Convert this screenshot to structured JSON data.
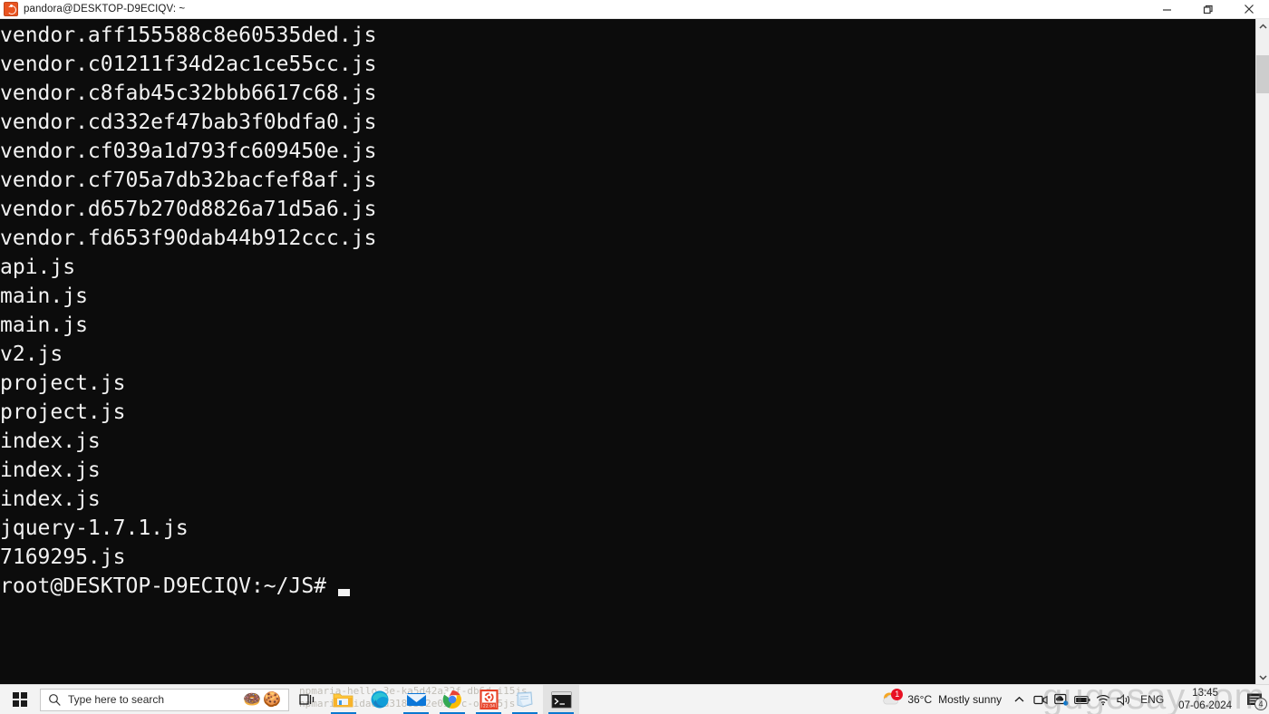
{
  "window": {
    "title": "pandora@DESKTOP-D9ECIQV: ~",
    "icon": "ubuntu-icon",
    "minimize_label": "Minimize",
    "maximize_label": "Restore",
    "close_label": "Close"
  },
  "terminal": {
    "background": "#0c0c0c",
    "foreground": "#f2f2f2",
    "lines": [
      "vendor.aff155588c8e60535ded.js",
      "vendor.c01211f34d2ac1ce55cc.js",
      "vendor.c8fab45c32bbb6617c68.js",
      "vendor.cd332ef47bab3f0bdfa0.js",
      "vendor.cf039a1d793fc609450e.js",
      "vendor.cf705a7db32bacfef8af.js",
      "vendor.d657b270d8826a71d5a6.js",
      "vendor.fd653f90dab44b912ccc.js",
      "api.js",
      "main.js",
      "main.js",
      "v2.js",
      "project.js",
      "project.js",
      "index.js",
      "index.js",
      "index.js",
      "jquery-1.7.1.js",
      "7169295.js"
    ],
    "prompt": "root@DESKTOP-D9ECIQV:~/JS#"
  },
  "scrollbar": {
    "up_arrow": "chevron-up-icon",
    "down_arrow": "chevron-down-icon"
  },
  "taskbar": {
    "start_label": "Start",
    "search": {
      "placeholder": "Type here to search",
      "emoji": "🍩🍪"
    },
    "ghost_text": "npmaria-hello-3e-ka5d42a32f-db6d-i15js\nnpmaria-hidaena3180352e0517c-o-i15js",
    "apps": [
      {
        "name": "task-view",
        "label": "Task View",
        "running": false
      },
      {
        "name": "file-explorer",
        "label": "File Explorer",
        "running": true
      },
      {
        "name": "microsoft-edge",
        "label": "Microsoft Edge",
        "running": false
      },
      {
        "name": "mail",
        "label": "Mail",
        "running": true
      },
      {
        "name": "google-chrome",
        "label": "Google Chrome",
        "running": true
      },
      {
        "name": "ubuntu",
        "label": "Ubuntu 22.04",
        "running": true
      },
      {
        "name": "sticky-notes",
        "label": "Sticky Notes",
        "running": true
      },
      {
        "name": "windows-terminal",
        "label": "Terminal",
        "running": true
      }
    ],
    "ubuntu_version": "22.04",
    "weather": {
      "temperature": "36°C",
      "condition": "Mostly sunny",
      "badge": "1"
    },
    "tray": {
      "chevron": "chevron-up-icon",
      "language": "ENG",
      "time": "13:45",
      "date": "07-06-2024",
      "notification_count": "4"
    }
  },
  "watermark": "gugesay.com",
  "colors": {
    "accent": "#0b78d0",
    "taskbar_bg": "#f3f3f3",
    "terminal_bg": "#0c0c0c",
    "ubuntu_orange": "#e95420",
    "badge_red": "#e81123"
  }
}
